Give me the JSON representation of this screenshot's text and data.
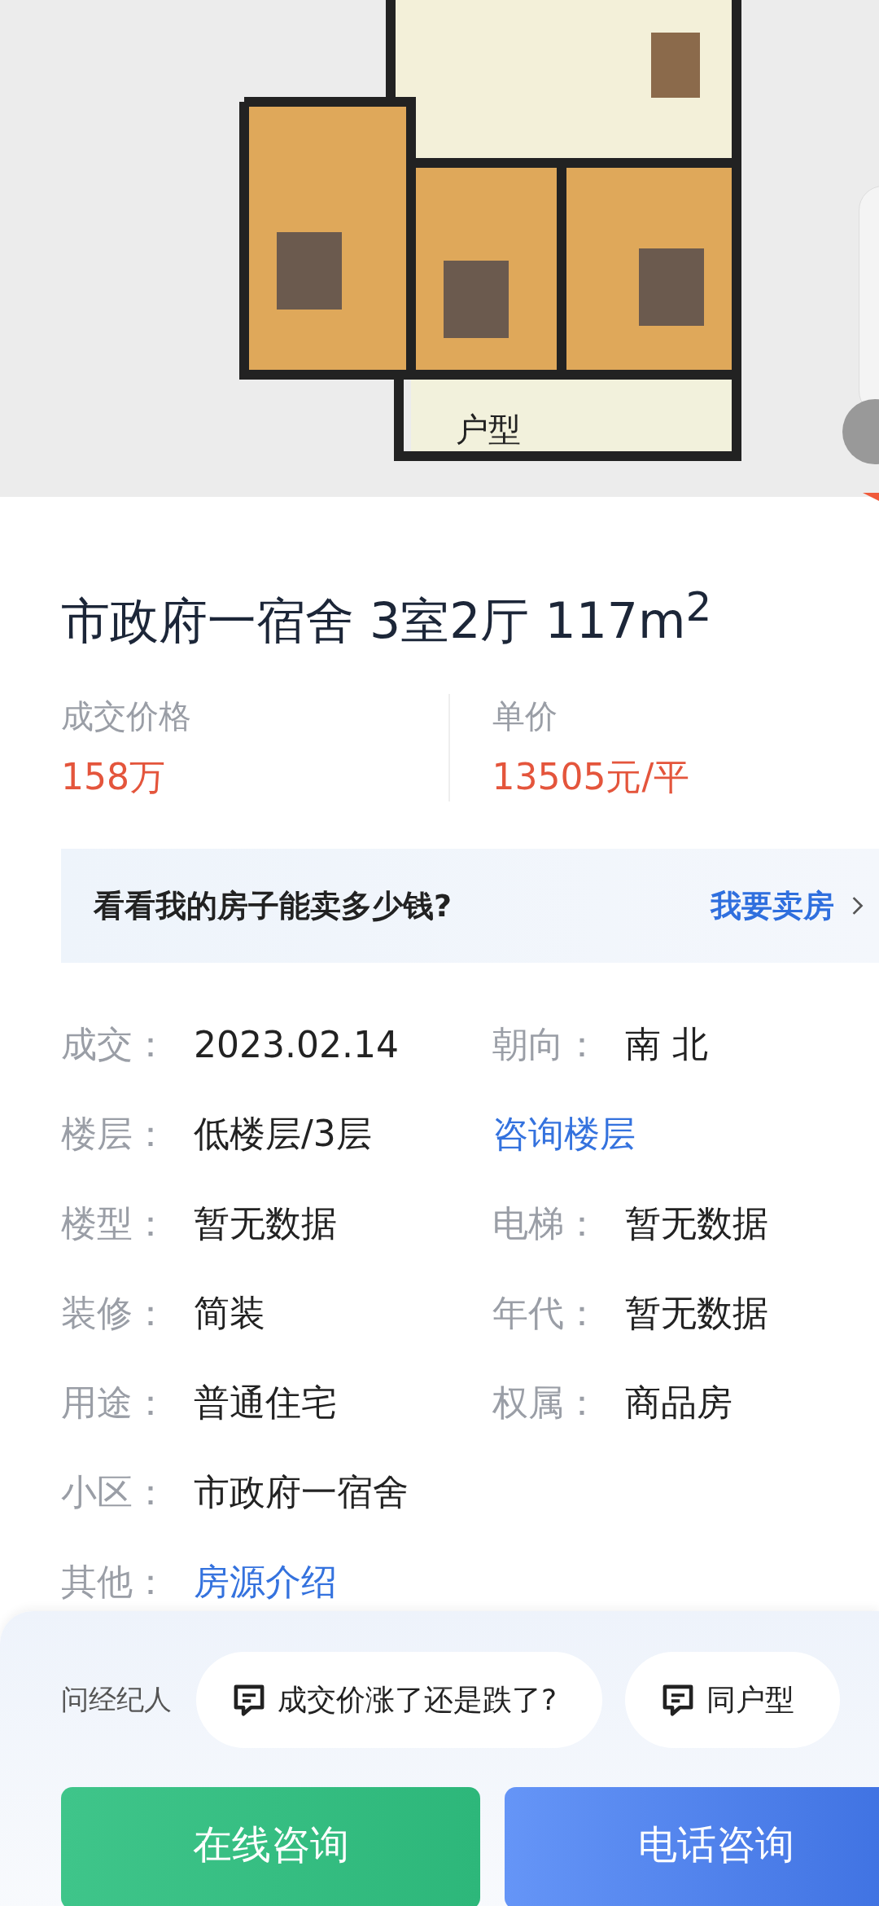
{
  "floorplan": {
    "kind": "picture",
    "label": "户型"
  },
  "title": "市政府一宿舍 3室2厅 117m$^{2}$",
  "prices": [
    {
      "label": "成交价格",
      "value": "158万"
    },
    {
      "label": "单价",
      "value": "13505元/平"
    }
  ],
  "banner": {
    "text": "看看我的房子能卖多少钱?",
    "link": "我要卖房"
  },
  "details": [
    {
      "cells": [
        {
          "kind": "text",
          "label": "成交：",
          "value": "2023.02.14"
        },
        {
          "kind": "text",
          "label": "朝向：",
          "value": "南 北"
        }
      ]
    },
    {
      "cells": [
        {
          "kind": "text",
          "label": "楼层：",
          "value": "低楼层/3层"
        },
        {
          "kind": "link",
          "value": "咨询楼层"
        }
      ]
    },
    {
      "cells": [
        {
          "kind": "text",
          "label": "楼型：",
          "value": "暂无数据"
        },
        {
          "kind": "text",
          "label": "电梯：",
          "value": "暂无数据"
        }
      ]
    },
    {
      "cells": [
        {
          "kind": "text",
          "label": "装修：",
          "value": "简装"
        },
        {
          "kind": "text",
          "label": "年代：",
          "value": "暂无数据"
        }
      ]
    },
    {
      "cells": [
        {
          "kind": "text",
          "label": "用途：",
          "value": "普通住宅"
        },
        {
          "kind": "text",
          "label": "权属：",
          "value": "商品房"
        }
      ]
    },
    {
      "cells": [
        {
          "kind": "text",
          "label": "小区：",
          "value": "市政府一宿舍"
        }
      ]
    },
    {
      "cells": [
        {
          "kind": "link",
          "label": "其他：",
          "value": "房源介绍"
        }
      ]
    }
  ],
  "ask": {
    "label": "问经纪人",
    "chips": [
      "成交价涨了还是跌了?",
      "同户型"
    ]
  },
  "buttons": [
    {
      "kind": "online",
      "label": "在线咨询"
    },
    {
      "kind": "phone",
      "label": "电话咨询"
    }
  ]
}
